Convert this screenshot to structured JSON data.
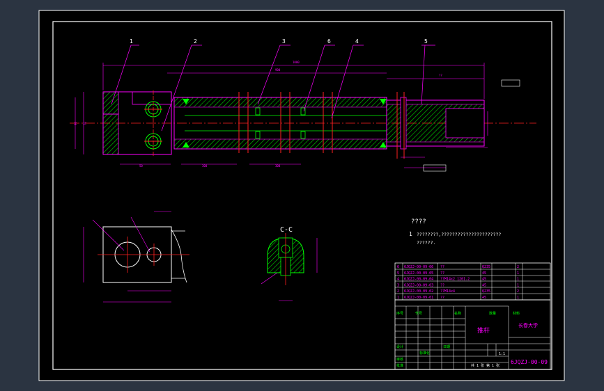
{
  "part_numbers": [
    "1",
    "2",
    "3",
    "6",
    "4",
    "5"
  ],
  "section_label": "C-C",
  "notes": {
    "heading": "????",
    "line1_number": "1",
    "line1": "????????,??????????????????????",
    "line2": "??????."
  },
  "bom": {
    "rows": [
      {
        "seq": "6",
        "code": "6JQZJ-00-09-06",
        "name": "??",
        "qty": "",
        "material": "Q235",
        "count": "2"
      },
      {
        "seq": "5",
        "code": "6JQZJ-00-09-05",
        "name": "??",
        "qty": "",
        "material": "45",
        "count": "1"
      },
      {
        "seq": "4",
        "code": "6JQZJ-00-09-04",
        "name": "??M14x2  1201.2",
        "qty": "",
        "material": "45",
        "count": "1"
      },
      {
        "seq": "3",
        "code": "6JQZJ-00-09-03",
        "name": "??",
        "qty": "",
        "material": "45",
        "count": "1"
      },
      {
        "seq": "2",
        "code": "6JQZJ-00-09-02",
        "name": "??M14x4",
        "qty": "",
        "material": "Q235",
        "count": "2"
      },
      {
        "seq": "1",
        "code": "6JQZJ-00-09-01",
        "name": "??",
        "qty": "",
        "material": "45",
        "count": "1"
      }
    ],
    "header": [
      "序号",
      "代号",
      "名称",
      "数量",
      "材料"
    ]
  },
  "title_block": {
    "part_name": "推杆",
    "school": "长春大学",
    "drawing_no": "6JQZJ-00-09",
    "scale": "1:1",
    "sheet": "共 1 张 第 1 张",
    "design_label": "设计",
    "check_label": "审核",
    "approve_label": "批准",
    "sub_label": "标准化",
    "date_label": "日期"
  },
  "colors": {
    "background": "#000000",
    "outer_bg": "#2b3441",
    "frame": "#ffffff",
    "outline": "#ff00ff",
    "centerline": "#ff2020",
    "hatch": "#00d000",
    "text_green": "#00ff00",
    "text_white": "#ffffff",
    "dim": "#ff00ff"
  }
}
